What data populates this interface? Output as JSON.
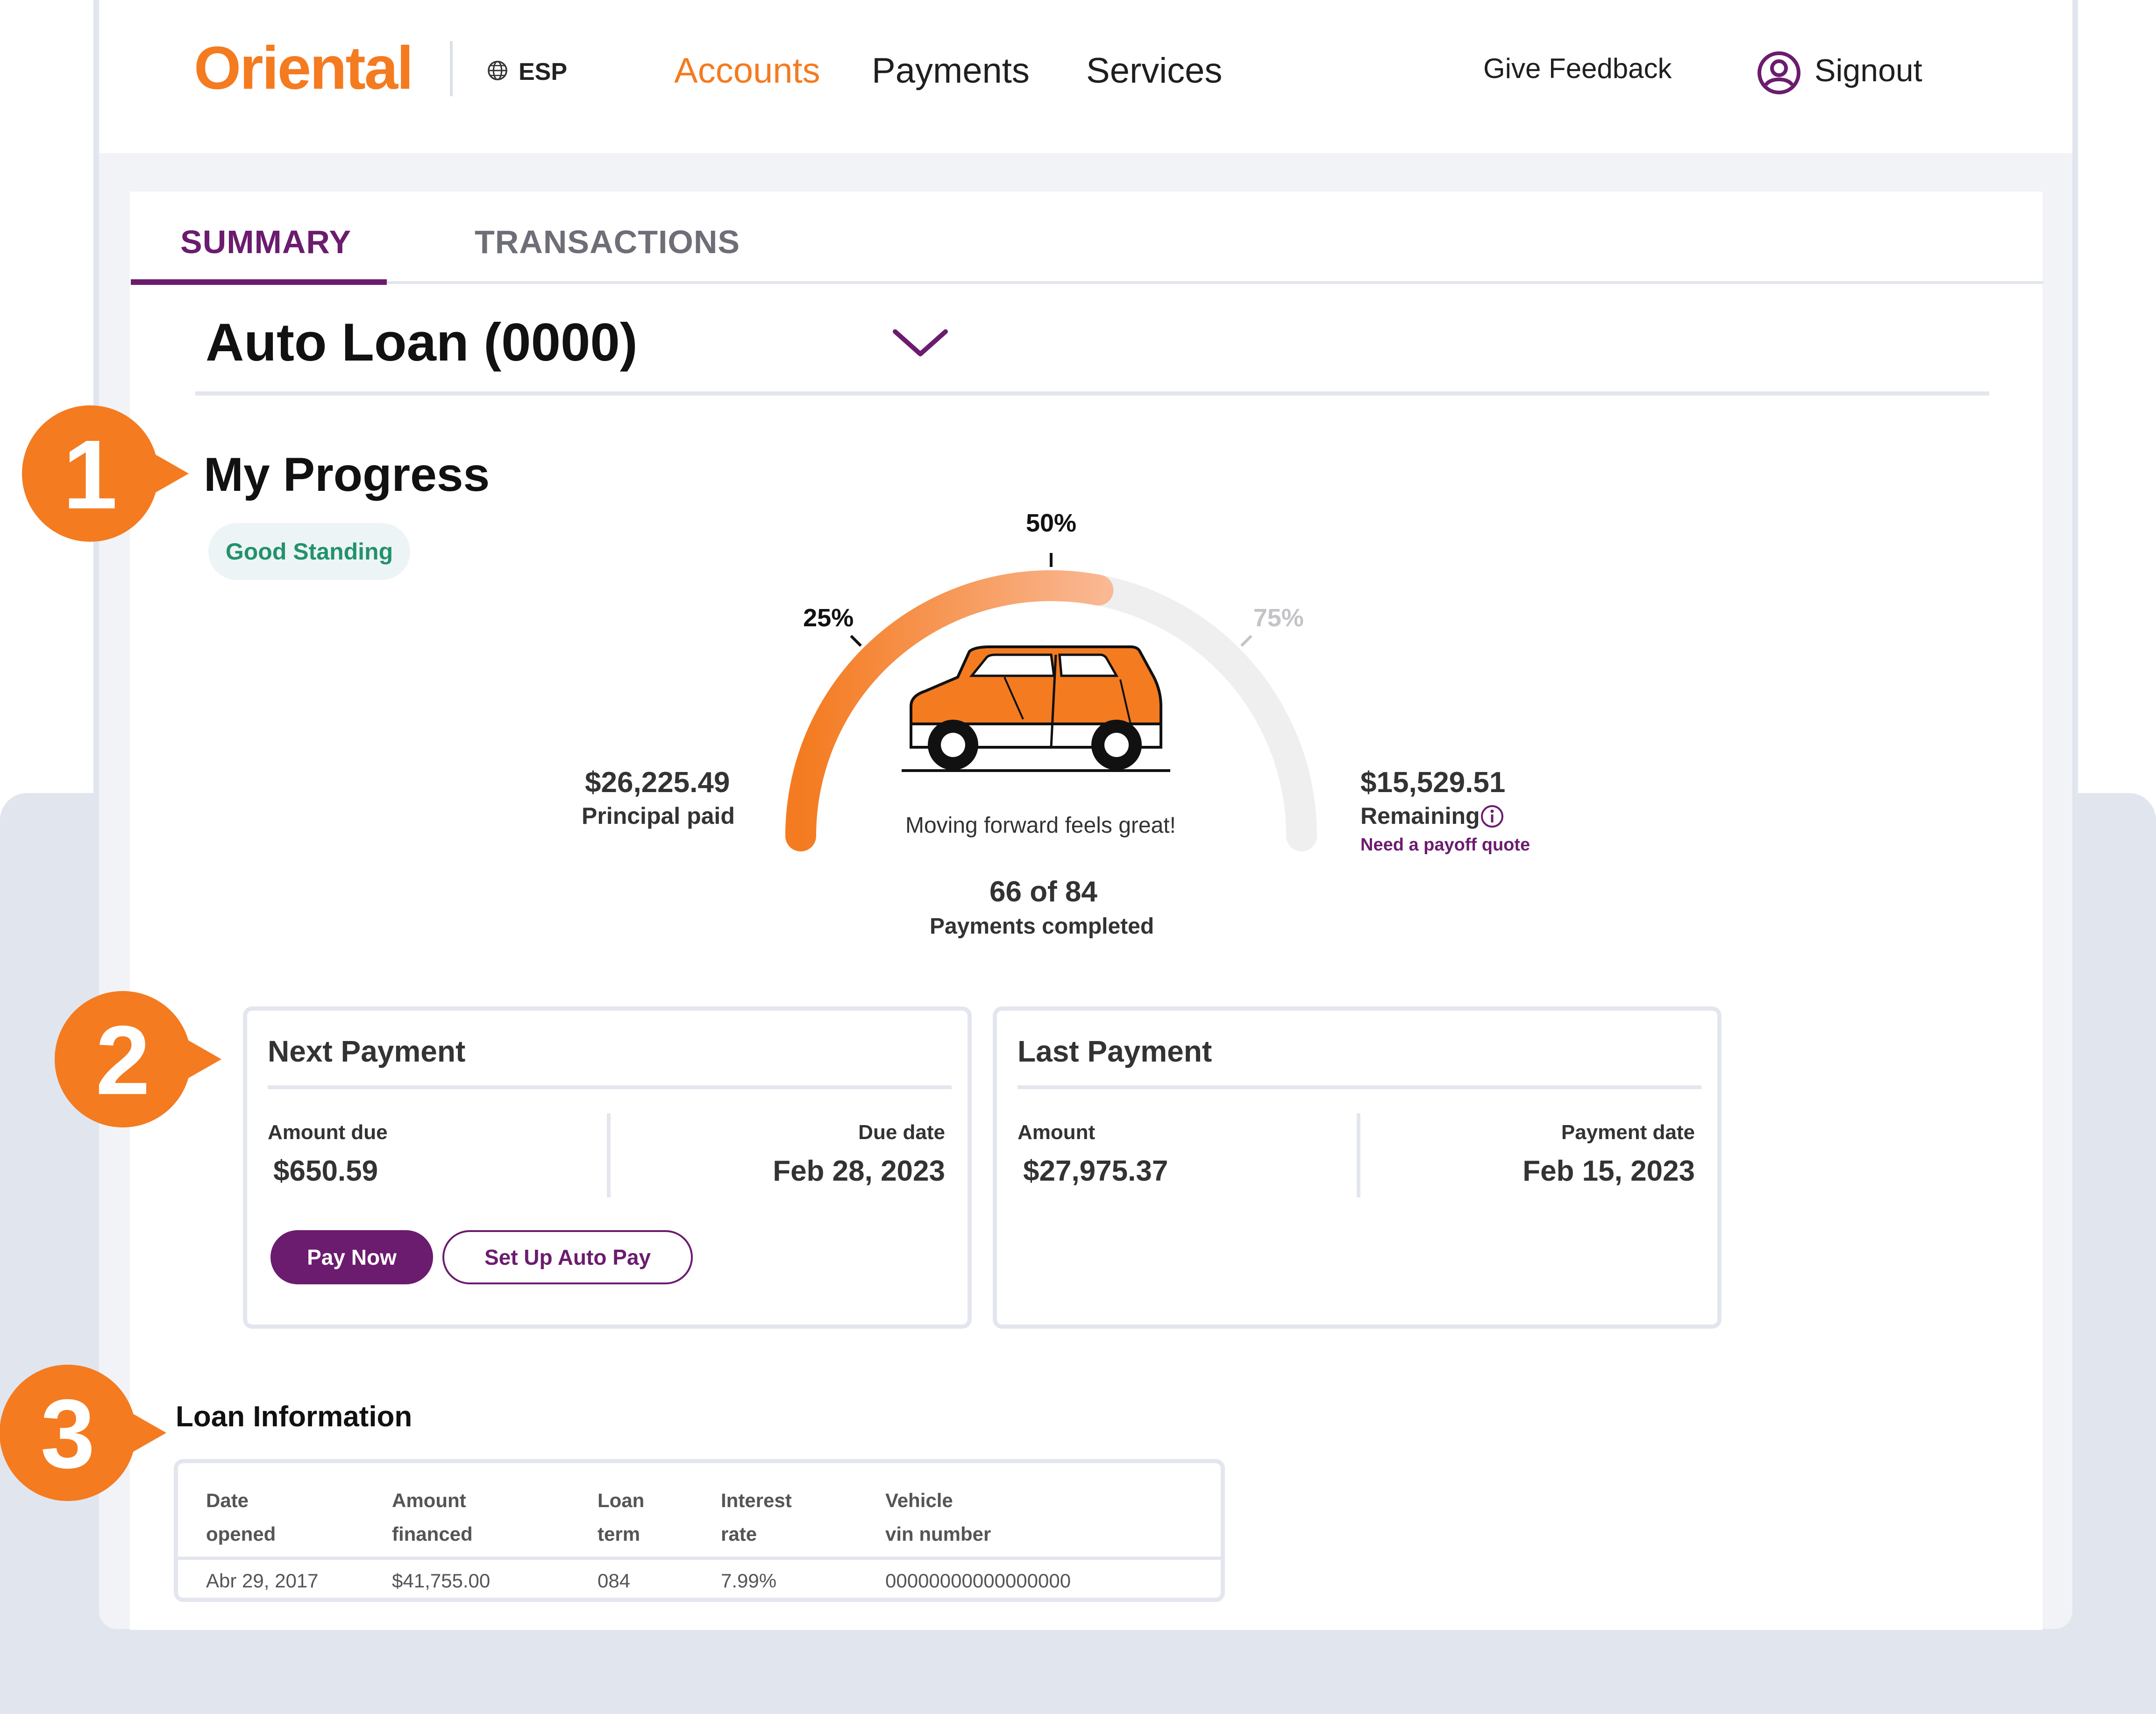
{
  "nav": {
    "logo": "Oriental",
    "language": "ESP",
    "links": [
      "Accounts",
      "Payments",
      "Services"
    ],
    "feedback": "Give Feedback",
    "signout": "Signout"
  },
  "tabs": [
    "SUMMARY",
    "TRANSACTIONS"
  ],
  "account": {
    "title": "Auto Loan (0000)"
  },
  "markers": [
    "1",
    "2",
    "3"
  ],
  "progress": {
    "heading": "My Progress",
    "standing": "Good Standing",
    "gauge": {
      "completed_fraction": 0.5,
      "tick_labels": [
        "25%",
        "50%",
        "75%"
      ],
      "caption": "Moving forward feels great!"
    },
    "principal_paid": {
      "value": "$26,225.49",
      "label": "Principal paid"
    },
    "remaining": {
      "value": "$15,529.51",
      "label": "Remaining",
      "link": "Need a payoff quote"
    },
    "payments": {
      "count": "66 of 84",
      "label": "Payments completed"
    }
  },
  "next_payment": {
    "title": "Next Payment",
    "amount_label": "Amount due",
    "amount": "$650.59",
    "date_label": "Due date",
    "date": "Feb 28, 2023",
    "pay_now": "Pay Now",
    "autopay": "Set Up Auto Pay"
  },
  "last_payment": {
    "title": "Last Payment",
    "amount_label": "Amount",
    "amount": "$27,975.37",
    "date_label": "Payment date",
    "date": "Feb 15, 2023"
  },
  "loan_info": {
    "heading": "Loan Information",
    "columns": [
      [
        "Date",
        "opened"
      ],
      [
        "Amount",
        "financed"
      ],
      [
        "Loan",
        "term"
      ],
      [
        "Interest",
        "rate"
      ],
      [
        "Vehicle",
        "vin number"
      ]
    ],
    "row": [
      "Abr 29, 2017",
      "$41,755.00",
      "084",
      "7.99%",
      "00000000000000000"
    ]
  },
  "colors": {
    "brand_orange": "#f47b20",
    "brand_purple": "#6b1c6e",
    "success_green": "#22926b",
    "gauge_track": "#efeff0"
  }
}
